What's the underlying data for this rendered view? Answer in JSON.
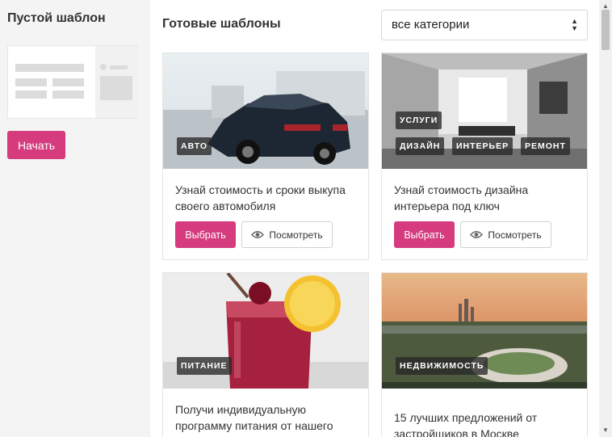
{
  "sidebar": {
    "title": "Пустой шаблон",
    "start_label": "Начать"
  },
  "main": {
    "title": "Готовые шаблоны",
    "category_select": "все категории"
  },
  "cards": [
    {
      "tags": [
        "АВТО"
      ],
      "title": "Узнай стоимость и сроки выкупа своего автомобиля",
      "select_label": "Выбрать",
      "view_label": "Посмотреть"
    },
    {
      "tags": [
        "УСЛУГИ",
        "ДИЗАЙН",
        "ИНТЕРЬЕР",
        "РЕМОНТ"
      ],
      "title": "Узнай стоимость дизайна интерьера под ключ",
      "select_label": "Выбрать",
      "view_label": "Посмотреть"
    },
    {
      "tags": [
        "ПИТАНИЕ"
      ],
      "title": "Получи индивидуальную программу питания от нашего"
    },
    {
      "tags": [
        "НЕДВИЖИМОСТЬ"
      ],
      "title": "15 лучших предложений от застройщиков в Москве"
    }
  ],
  "colors": {
    "accent": "#d63b7e",
    "sidebar_bg": "#f4f4f4",
    "tag_bg": "#2b2b2b"
  },
  "icons": {
    "view": "eye-icon",
    "select_arrows": "updown-icon"
  }
}
